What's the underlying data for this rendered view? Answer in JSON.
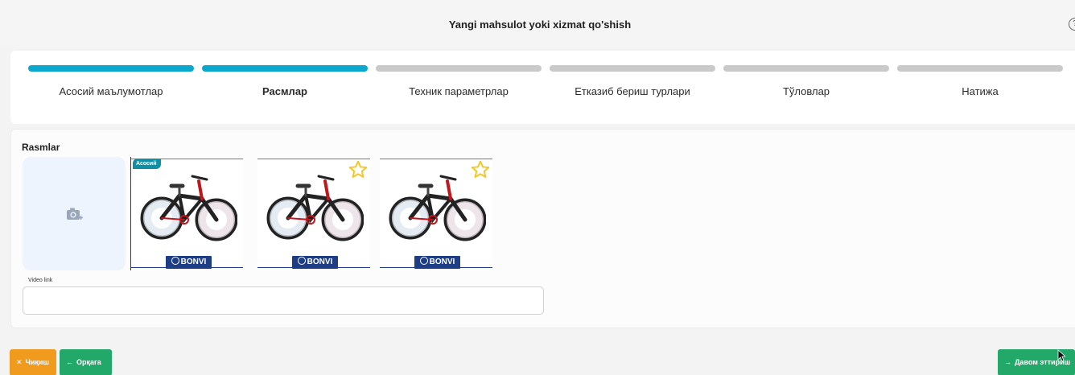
{
  "header": {
    "title": "Yangi mahsulot yoki xizmat qo'shish",
    "help_icon": "help-circle-icon"
  },
  "steps": [
    {
      "label": "Асосий маълумотлар",
      "active": true,
      "current": false
    },
    {
      "label": "Расмлар",
      "active": true,
      "current": true
    },
    {
      "label": "Техник параметрлар",
      "active": false,
      "current": false
    },
    {
      "label": "Етказиб бериш турлари",
      "active": false,
      "current": false
    },
    {
      "label": "Тўловлар",
      "active": false,
      "current": false
    },
    {
      "label": "Натижа",
      "active": false,
      "current": false
    }
  ],
  "images": {
    "title": "Rasmlar",
    "upload_icon": "camera-plus-icon",
    "main_badge": "Асосий",
    "brand": "BONVI",
    "thumbnails": [
      {
        "is_main": true
      },
      {
        "is_main": false
      },
      {
        "is_main": false
      }
    ],
    "video_label": "Video link",
    "video_value": ""
  },
  "buttons": {
    "exit": "Чиқиш",
    "back": "Орқага",
    "next": "Давом эттириш"
  },
  "colors": {
    "step_active": "#0aa7cf",
    "step_inactive": "#c9c9c9",
    "exit": "#f19b1e",
    "green": "#22a96a",
    "badge": "#0e8fa3",
    "brand": "#1d3d84",
    "star": "#f3c623"
  }
}
